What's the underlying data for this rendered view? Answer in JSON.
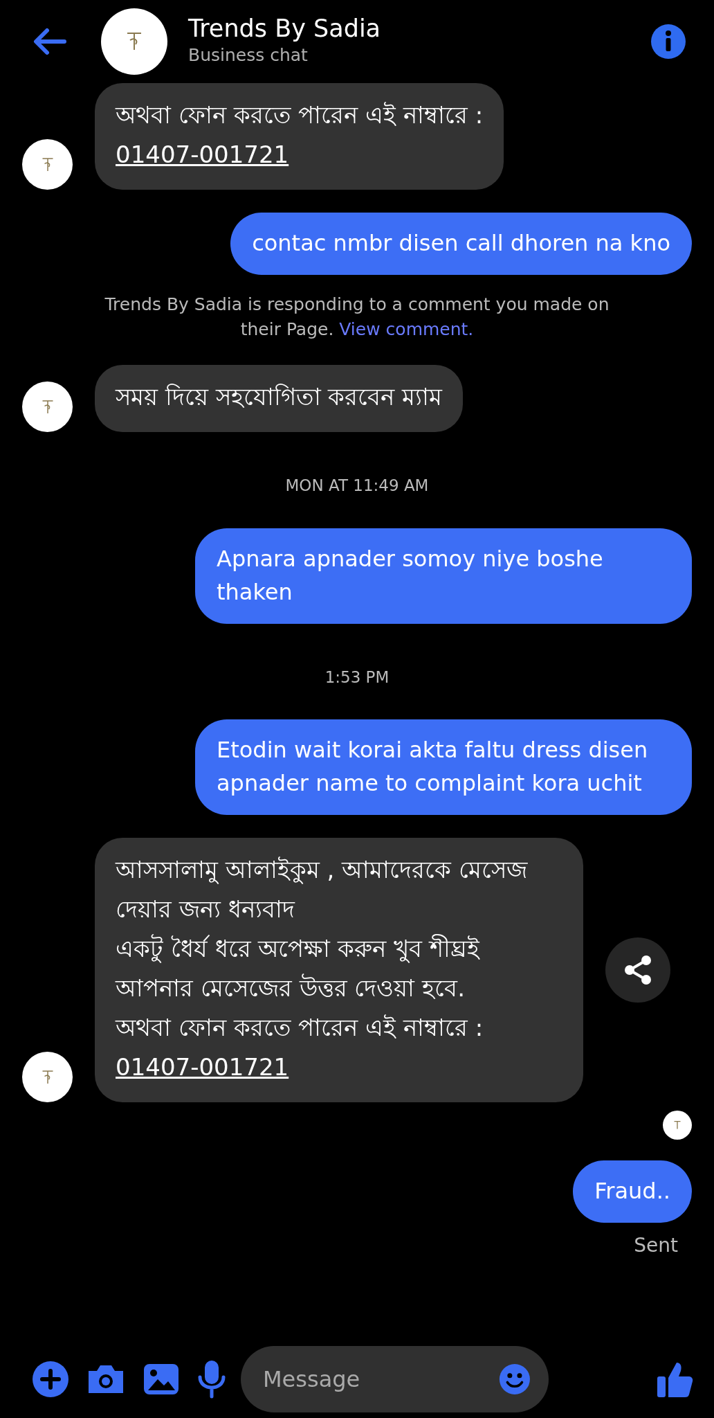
{
  "header": {
    "title": "Trends By Sadia",
    "subtitle": "Business chat"
  },
  "messages": [
    {
      "kind": "received",
      "paragraphs": [
        "অথবা ফোন করতে পারেন এই নাম্বারে :"
      ],
      "link": "01407-001721",
      "share_button": false
    },
    {
      "kind": "sent",
      "text": "contac nmbr disen call dhoren na kno"
    },
    {
      "kind": "notice",
      "text": "Trends By Sadia is responding to a comment you made on their Page.",
      "link": "View comment."
    },
    {
      "kind": "received",
      "paragraphs": [
        "সময় দিয়ে সহযোগিতা করবেন ম্যাম"
      ],
      "share_button": false
    },
    {
      "kind": "timestamp",
      "text": "MON AT 11:49 AM"
    },
    {
      "kind": "sent",
      "text": "Apnara apnader somoy niye boshe thaken"
    },
    {
      "kind": "timestamp",
      "text": "1:53 PM"
    },
    {
      "kind": "sent",
      "text": "Etodin wait korai akta faltu dress disen apnader name to complaint kora uchit"
    },
    {
      "kind": "received",
      "paragraphs": [
        "আসসালামু আলাইকুম , আমাদেরকে মেসেজ দেয়ার জন্য ধন্যবাদ",
        "একটু ধৈর্য ধরে অপেক্ষা করুন খুব শীঘ্রই আপনার মেসেজের উত্তর দেওয়া হবে.",
        "অথবা ফোন করতে পারেন এই নাম্বারে :"
      ],
      "link": "01407-001721",
      "share_button": true
    },
    {
      "kind": "seen"
    },
    {
      "kind": "sent",
      "text": "Fraud.."
    },
    {
      "kind": "status",
      "text": "Sent"
    }
  ],
  "composer": {
    "placeholder": "Message"
  }
}
